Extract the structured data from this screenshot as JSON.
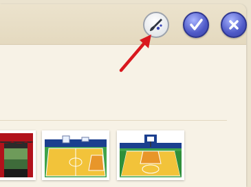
{
  "toolbar": {
    "buttons": [
      {
        "name": "brush-tool-button",
        "icon": "paintbrush-icon"
      },
      {
        "name": "confirm-button",
        "icon": "checkmark-icon"
      },
      {
        "name": "close-button",
        "icon": "close-icon"
      }
    ]
  },
  "annotation": {
    "icon": "red-arrow-pointer",
    "color": "#d9181e"
  },
  "backgrounds": {
    "thumbnails": [
      {
        "name": "background-thumb-stage",
        "theme": "stage with red curtains"
      },
      {
        "name": "background-thumb-basketball-court-1",
        "theme": "basketball court"
      },
      {
        "name": "background-thumb-basketball-court-2",
        "theme": "basketball court with hoop"
      }
    ]
  },
  "colors": {
    "panel": "#f7f2e6",
    "header": "#e4d9bf",
    "button_blue": "#4e59c7",
    "court_yellow": "#f2c33a",
    "court_green": "#3fa34a"
  }
}
